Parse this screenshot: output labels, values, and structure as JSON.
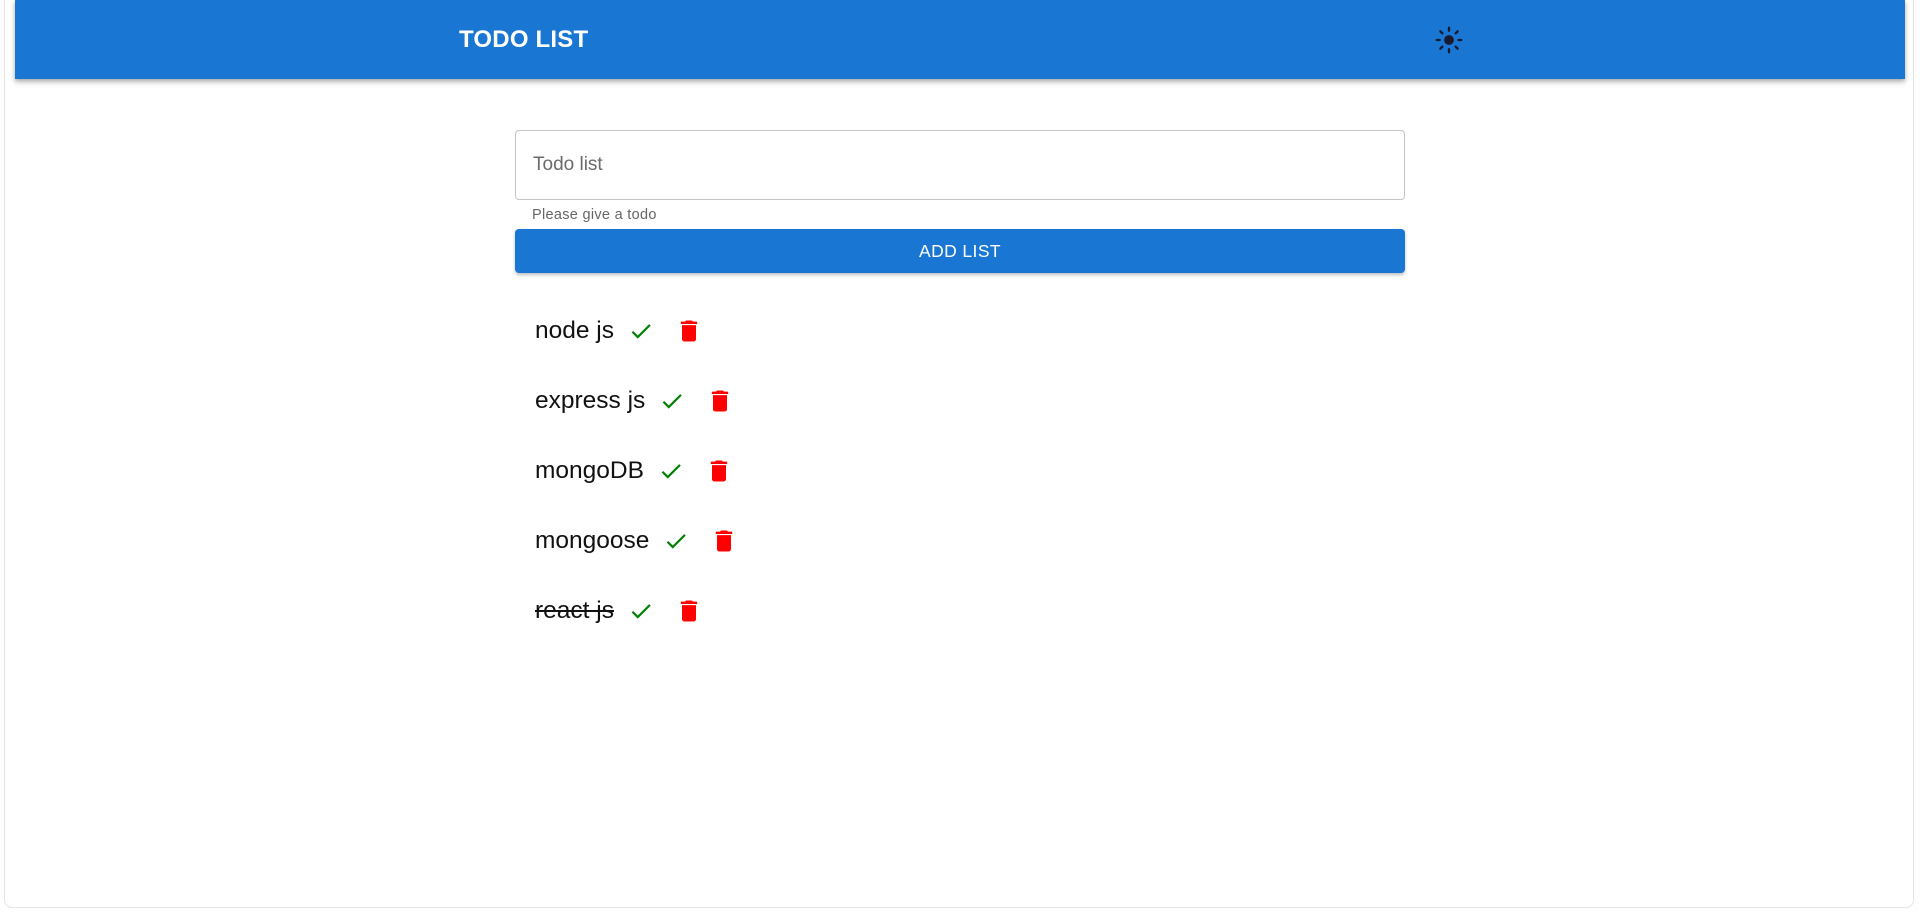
{
  "header": {
    "title": "TODO LIST",
    "theme_toggle_icon": "sun-icon",
    "background_color": "#1976d2"
  },
  "form": {
    "input_placeholder": "Todo list",
    "input_value": "",
    "helper_text": "Please give a todo",
    "add_button_label": "ADD LIST"
  },
  "todos": [
    {
      "text": "node js",
      "completed": false
    },
    {
      "text": "express js",
      "completed": false
    },
    {
      "text": "mongoDB",
      "completed": false
    },
    {
      "text": "mongoose",
      "completed": false
    },
    {
      "text": "react js",
      "completed": true
    }
  ],
  "icons": {
    "complete": "check-icon",
    "delete": "trash-icon"
  },
  "colors": {
    "accent": "#1976d2",
    "check": "#008000",
    "delete": "#ff0000"
  }
}
